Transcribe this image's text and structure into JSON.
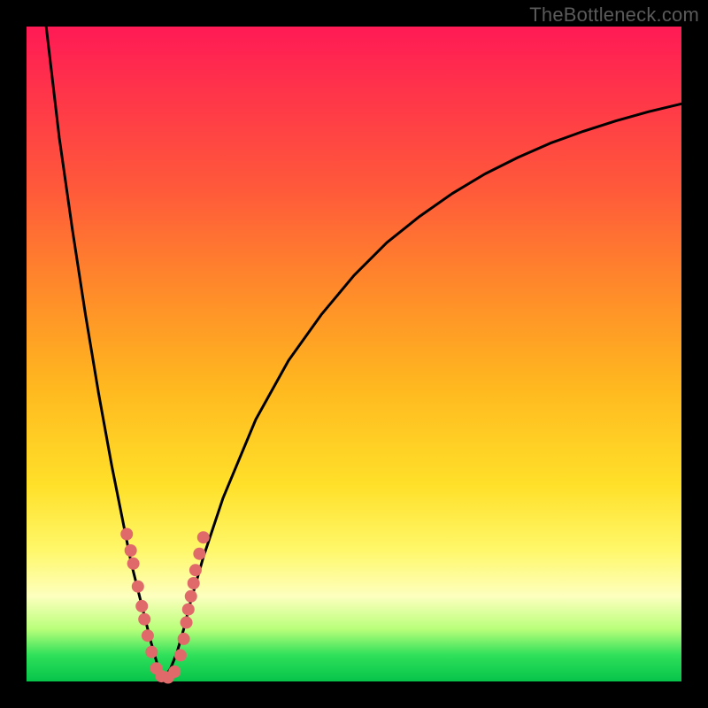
{
  "watermark": "TheBottleneck.com",
  "chart_data": {
    "type": "line",
    "title": "",
    "xlabel": "",
    "ylabel": "",
    "xlim": [
      0,
      100
    ],
    "ylim": [
      0,
      100
    ],
    "grid": false,
    "legend": false,
    "notch_x": 21,
    "series": [
      {
        "name": "left-branch",
        "x": [
          3,
          5,
          7,
          9,
          11,
          13,
          15,
          16,
          17,
          18,
          19,
          20,
          21
        ],
        "y": [
          100,
          83,
          69,
          56,
          44,
          33,
          23,
          18,
          14,
          10,
          6,
          2.5,
          0.5
        ]
      },
      {
        "name": "right-branch",
        "x": [
          21,
          22,
          23,
          24,
          25,
          27,
          30,
          35,
          40,
          45,
          50,
          55,
          60,
          65,
          70,
          75,
          80,
          85,
          90,
          95,
          100
        ],
        "y": [
          0.5,
          2,
          4.5,
          8,
          12,
          19,
          28,
          40,
          49,
          56,
          62,
          67,
          71,
          74.5,
          77.5,
          80,
          82.2,
          84,
          85.6,
          87,
          88.2
        ]
      }
    ],
    "markers": {
      "name": "marker-dots",
      "color": "#e06a6a",
      "radius_px": 7,
      "x": [
        15.3,
        15.9,
        16.3,
        17.0,
        17.6,
        18.0,
        18.5,
        19.1,
        19.8,
        20.6,
        21.6,
        22.6,
        23.5,
        24.0,
        24.4,
        24.7,
        25.1,
        25.5,
        25.8,
        26.4,
        27.0
      ],
      "y": [
        22.5,
        20.0,
        18.0,
        14.5,
        11.5,
        9.5,
        7.0,
        4.5,
        2.0,
        0.8,
        0.6,
        1.5,
        4.0,
        6.5,
        9.0,
        11.0,
        13.0,
        15.0,
        17.0,
        19.5,
        22.0
      ]
    }
  }
}
